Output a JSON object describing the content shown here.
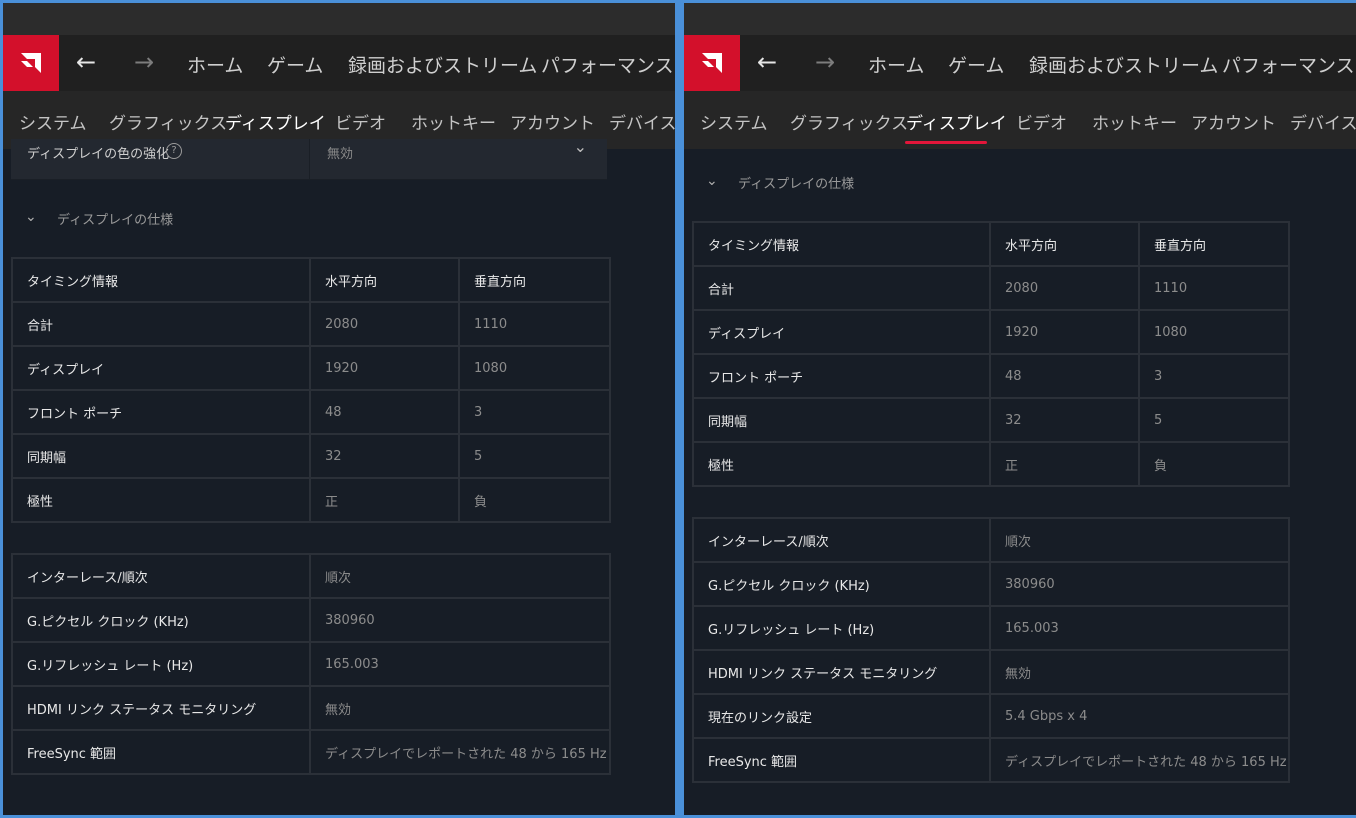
{
  "nav": {
    "back": "←",
    "forward": "→",
    "links": [
      "ホーム",
      "ゲーム",
      "録画およびストリーム",
      "パフォーマンス"
    ]
  },
  "subtabs": [
    "システム",
    "グラフィックス",
    "ディスプレイ",
    "ビデオ",
    "ホットキー",
    "アカウント",
    "デバイス"
  ],
  "active_subtab": "ディスプレイ",
  "partial_row": {
    "label": "ディスプレイの色の強化",
    "value": "無効",
    "help": "?"
  },
  "section": {
    "title": "ディスプレイの仕様",
    "chevron": "⌄"
  },
  "timing_table": {
    "headers": [
      "タイミング情報",
      "水平方向",
      "垂直方向"
    ],
    "rows": [
      [
        "合計",
        "2080",
        "1110"
      ],
      [
        "ディスプレイ",
        "1920",
        "1080"
      ],
      [
        "フロント ポーチ",
        "48",
        "3"
      ],
      [
        "同期幅",
        "32",
        "5"
      ],
      [
        "極性",
        "正",
        "負"
      ]
    ]
  },
  "left_info": [
    [
      "インターレース/順次",
      "順次"
    ],
    [
      "G.ピクセル クロック (KHz)",
      "380960"
    ],
    [
      "G.リフレッシュ レート (Hz)",
      "165.003"
    ],
    [
      "HDMI リンク ステータス モニタリング",
      "無効"
    ],
    [
      "FreeSync 範囲",
      "ディスプレイでレポートされた 48 から 165 Hz"
    ]
  ],
  "right_info": [
    [
      "インターレース/順次",
      "順次"
    ],
    [
      "G.ピクセル クロック (KHz)",
      "380960"
    ],
    [
      "G.リフレッシュ レート (Hz)",
      "165.003"
    ],
    [
      "HDMI リンク ステータス モニタリング",
      "無効"
    ],
    [
      "現在のリンク設定",
      "5.4 Gbps x 4"
    ],
    [
      "FreeSync 範囲",
      "ディスプレイでレポートされた 48 から 165 Hz"
    ]
  ],
  "colors": {
    "accent": "#e3163a",
    "logo_bg": "#d3102b",
    "frame": "#4a90d9",
    "content_bg": "#171d26"
  },
  "icons": {
    "logo": "amd-logo-icon",
    "back": "arrow-left-icon",
    "forward": "arrow-right-icon",
    "section": "chevron-down-icon"
  }
}
